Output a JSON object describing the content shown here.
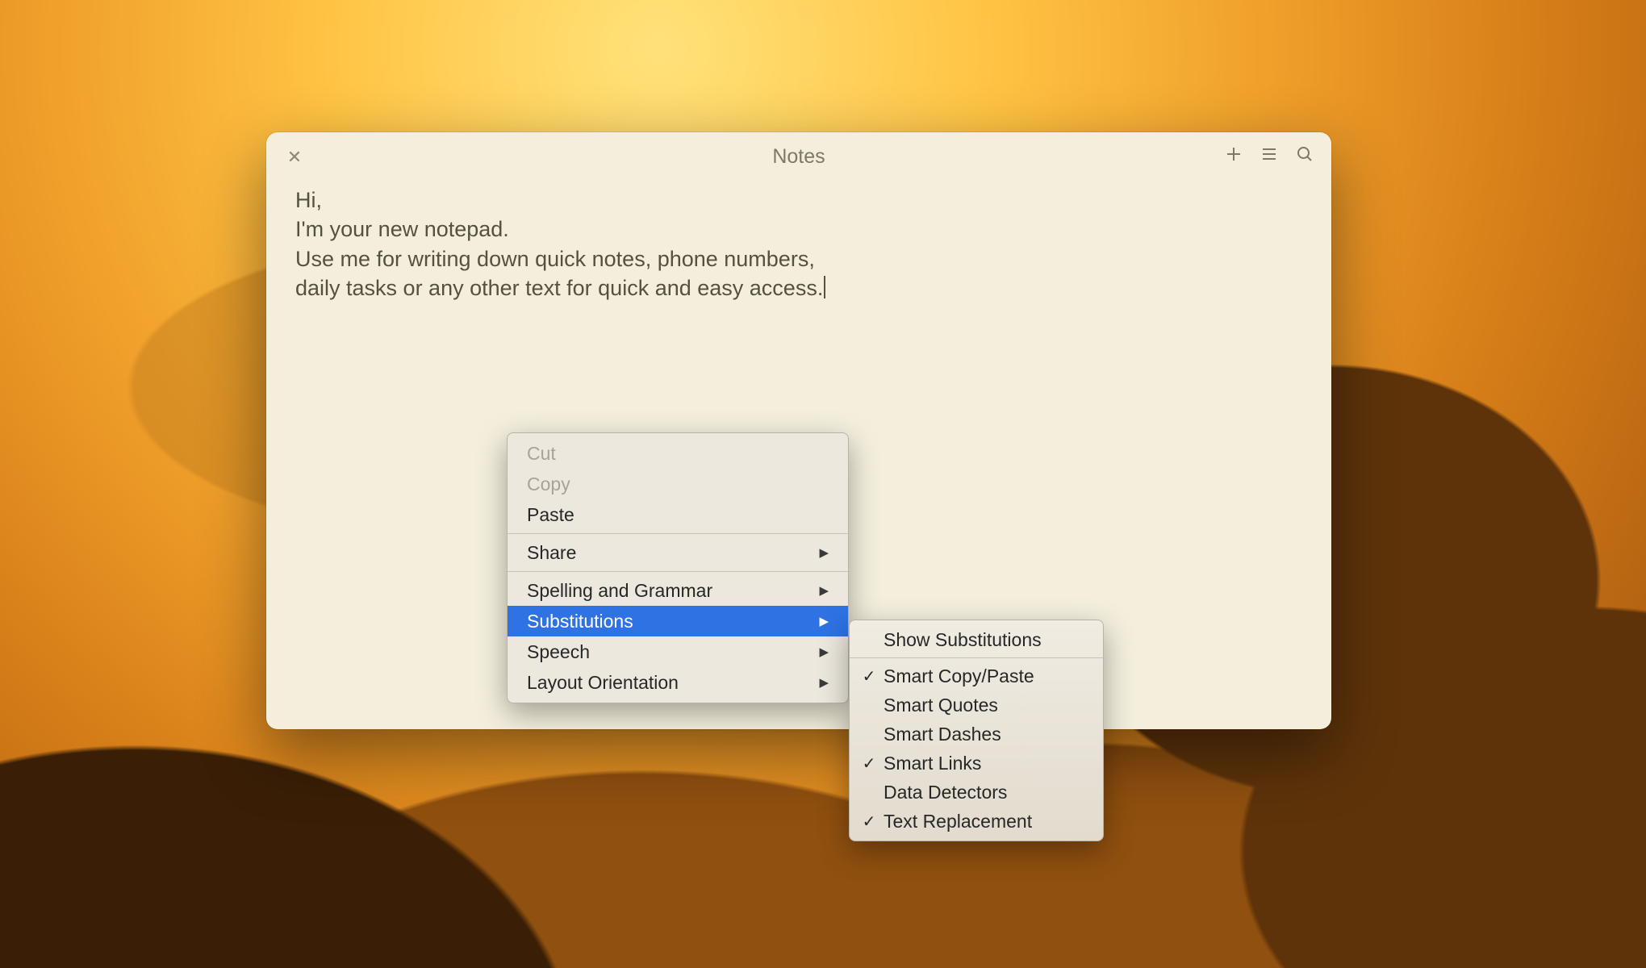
{
  "window": {
    "title": "Notes"
  },
  "note": {
    "lines": [
      "Hi,",
      "I'm your new notepad.",
      "",
      "Use me for writing down quick notes, phone numbers,",
      "daily tasks or any other text for quick and easy access."
    ]
  },
  "context_menu": {
    "cut": "Cut",
    "copy": "Copy",
    "paste": "Paste",
    "share": "Share",
    "spelling": "Spelling and Grammar",
    "substitutions": "Substitutions",
    "speech": "Speech",
    "layout": "Layout Orientation"
  },
  "sub_menu": {
    "show": "Show Substitutions",
    "smart_copy_paste": "Smart Copy/Paste",
    "smart_quotes": "Smart Quotes",
    "smart_dashes": "Smart Dashes",
    "smart_links": "Smart Links",
    "data_detectors": "Data Detectors",
    "text_replacement": "Text Replacement"
  }
}
